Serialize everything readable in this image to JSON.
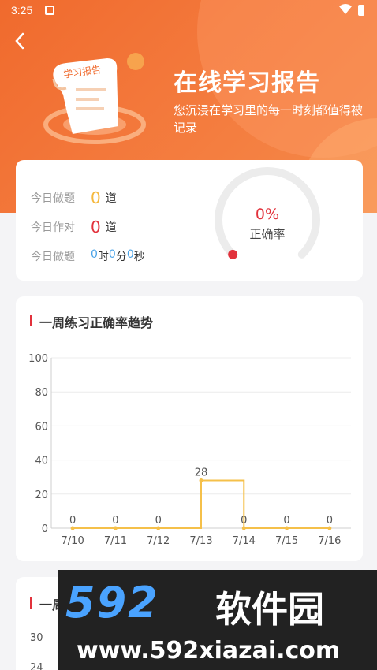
{
  "status_bar": {
    "time": "3:25"
  },
  "header": {
    "title": "在线学习报告",
    "subtitle": "您沉浸在学习里的每一时刻都值得被记录",
    "illustration_text": "学习报告"
  },
  "summary": {
    "today_questions": {
      "label": "今日做题",
      "value": "0",
      "unit": "道"
    },
    "today_correct": {
      "label": "今日作对",
      "value": "0",
      "unit": "道"
    },
    "today_time": {
      "label": "今日做题",
      "hours": "0",
      "hours_unit": "时",
      "minutes": "0",
      "minutes_unit": "分",
      "seconds": "0",
      "seconds_unit": "秒"
    },
    "accuracy": {
      "value": "0%",
      "label": "正确率",
      "fraction": 0
    }
  },
  "weekly_chart": {
    "title": "一周练习正确率趋势"
  },
  "chart_data": {
    "type": "line",
    "categories": [
      "7/10",
      "7/11",
      "7/12",
      "7/13",
      "7/14",
      "7/15",
      "7/16"
    ],
    "values": [
      0,
      0,
      0,
      28,
      0,
      0,
      0
    ],
    "data_labels": [
      "0",
      "0",
      "0",
      "28",
      "0",
      "0",
      "0"
    ],
    "yticks": [
      "0",
      "20",
      "40",
      "60",
      "80",
      "100"
    ],
    "ylim": [
      0,
      100
    ],
    "step": true,
    "grid": true,
    "color": "#f5c04a"
  },
  "second_chart": {
    "title": "一周",
    "yticks": [
      "30",
      "24"
    ]
  },
  "watermark": {
    "brand": "592",
    "name": "软件园",
    "url": "www.592xiazai.com"
  },
  "colors": {
    "accent": "#f06a2d",
    "red": "#e2323c",
    "yellow": "#f5b83d",
    "blue": "#4aa3e8"
  }
}
